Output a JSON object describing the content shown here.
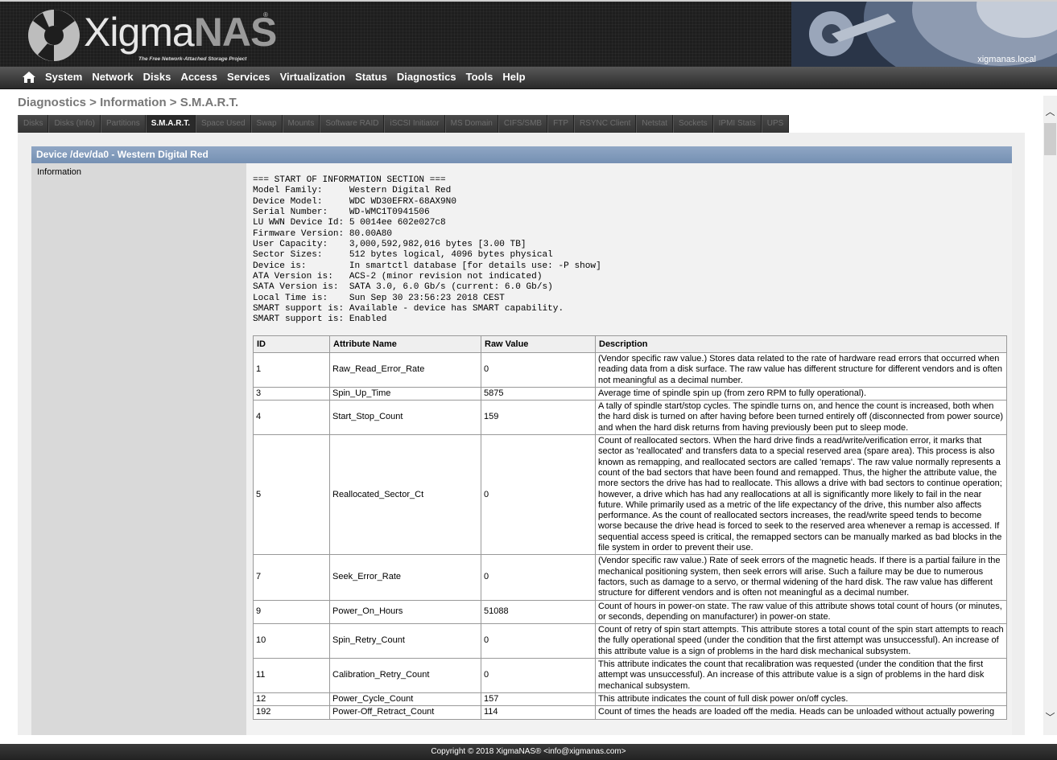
{
  "header": {
    "logo_main": "Xigma",
    "logo_accent": "NAS",
    "registered": "®",
    "tagline": "The Free Network-Attached Storage Project",
    "hostname": "xigmanas.local"
  },
  "nav": {
    "home_icon": "home-icon",
    "items": [
      "System",
      "Network",
      "Disks",
      "Access",
      "Services",
      "Virtualization",
      "Status",
      "Diagnostics",
      "Tools",
      "Help"
    ]
  },
  "breadcrumb": "Diagnostics > Information > S.M.A.R.T.",
  "tabs": [
    "Disks",
    "Disks (Info)",
    "Partitions",
    "S.M.A.R.T.",
    "Space Used",
    "Swap",
    "Mounts",
    "Software RAID",
    "iSCSI Initiator",
    "MS Domain",
    "CIFS/SMB",
    "FTP",
    "RSYNC Client",
    "Netstat",
    "Sockets",
    "IPMI Stats",
    "UPS"
  ],
  "active_tab": "S.M.A.R.T.",
  "device": {
    "title": "Device /dev/da0 - Western Digital Red",
    "left_label": "Information",
    "info_lines": [
      "=== START OF INFORMATION SECTION ===",
      "Model Family:     Western Digital Red",
      "Device Model:     WDC WD30EFRX-68AX9N0",
      "Serial Number:    WD-WMC1T0941506",
      "LU WWN Device Id: 5 0014ee 602e027c8",
      "Firmware Version: 80.00A80",
      "User Capacity:    3,000,592,982,016 bytes [3.00 TB]",
      "Sector Sizes:     512 bytes logical, 4096 bytes physical",
      "Device is:        In smartctl database [for details use: -P show]",
      "ATA Version is:   ACS-2 (minor revision not indicated)",
      "SATA Version is:  SATA 3.0, 6.0 Gb/s (current: 6.0 Gb/s)",
      "Local Time is:    Sun Sep 30 23:56:23 2018 CEST",
      "SMART support is: Available - device has SMART capability.",
      "SMART support is: Enabled"
    ]
  },
  "table": {
    "headers": [
      "ID",
      "Attribute Name",
      "Raw Value",
      "Description"
    ],
    "rows": [
      [
        "1",
        "Raw_Read_Error_Rate",
        "0",
        "(Vendor specific raw value.) Stores data related to the rate of hardware read errors that occurred when reading data from a disk surface. The raw value has different structure for different vendors and is often not meaningful as a decimal number."
      ],
      [
        "3",
        "Spin_Up_Time",
        "5875",
        "Average time of spindle spin up (from zero RPM to fully operational)."
      ],
      [
        "4",
        "Start_Stop_Count",
        "159",
        "A tally of spindle start/stop cycles. The spindle turns on, and hence the count is increased, both when the hard disk is turned on after having before been turned entirely off (disconnected from power source) and when the hard disk returns from having previously been put to sleep mode."
      ],
      [
        "5",
        "Reallocated_Sector_Ct",
        "0",
        "Count of reallocated sectors. When the hard drive finds a read/write/verification error, it marks that sector as 'reallocated' and transfers data to a special reserved area (spare area). This process is also known as remapping, and reallocated sectors are called 'remaps'. The raw value normally represents a count of the bad sectors that have been found and remapped. Thus, the higher the attribute value, the more sectors the drive has had to reallocate. This allows a drive with bad sectors to continue operation; however, a drive which has had any reallocations at all is significantly more likely to fail in the near future. While primarily used as a metric of the life expectancy of the drive, this number also affects performance. As the count of reallocated sectors increases, the read/write speed tends to become worse because the drive head is forced to seek to the reserved area whenever a remap is accessed. If sequential access speed is critical, the remapped sectors can be manually marked as bad blocks in the file system in order to prevent their use."
      ],
      [
        "7",
        "Seek_Error_Rate",
        "0",
        "(Vendor specific raw value.) Rate of seek errors of the magnetic heads. If there is a partial failure in the mechanical positioning system, then seek errors will arise. Such a failure may be due to numerous factors, such as damage to a servo, or thermal widening of the hard disk. The raw value has different structure for different vendors and is often not meaningful as a decimal number."
      ],
      [
        "9",
        "Power_On_Hours",
        "51088",
        "Count of hours in power-on state. The raw value of this attribute shows total count of hours (or minutes, or seconds, depending on manufacturer) in power-on state."
      ],
      [
        "10",
        "Spin_Retry_Count",
        "0",
        "Count of retry of spin start attempts. This attribute stores a total count of the spin start attempts to reach the fully operational speed (under the condition that the first attempt was unsuccessful). An increase of this attribute value is a sign of problems in the hard disk mechanical subsystem."
      ],
      [
        "11",
        "Calibration_Retry_Count",
        "0",
        "This attribute indicates the count that recalibration was requested (under the condition that the first attempt was unsuccessful). An increase of this attribute value is a sign of problems in the hard disk mechanical subsystem."
      ],
      [
        "12",
        "Power_Cycle_Count",
        "157",
        "This attribute indicates the count of full disk power on/off cycles."
      ],
      [
        "192",
        "Power-Off_Retract_Count",
        "114",
        "Count of times the heads are loaded off the media. Heads can be unloaded without actually powering"
      ]
    ]
  },
  "footer": "Copyright © 2018 XigmaNAS® <info@xigmanas.com>",
  "scrollbar": {
    "up_icon": "chevron-up-icon",
    "down_icon": "chevron-down-icon",
    "up_glyph": "︿",
    "down_glyph": "﹀"
  },
  "colors": {
    "device_title_bar": "#7f99bb",
    "nav_bg": "#3a3a3a",
    "header_bg": "#1e1e1e"
  }
}
